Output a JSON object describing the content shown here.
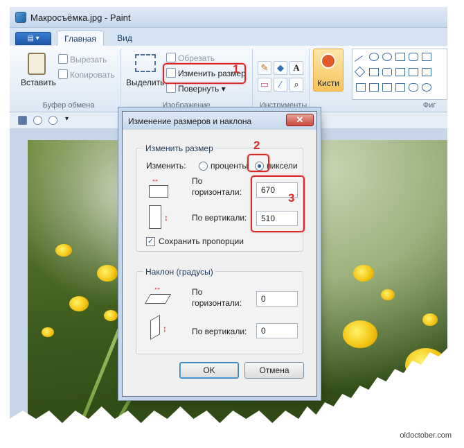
{
  "window": {
    "title": "Макросъёмка.jpg - Paint"
  },
  "tabs": [
    {
      "label": "Главная"
    },
    {
      "label": "Вид"
    }
  ],
  "ribbon": {
    "clipboard": {
      "paste_label": "Вставить",
      "cut_label": "Вырезать",
      "copy_label": "Копировать",
      "group_label": "Буфер обмена"
    },
    "image": {
      "select_label": "Выделить",
      "crop_label": "Обрезать",
      "resize_label": "Изменить размер",
      "rotate_label": "Повернуть",
      "group_label": "Изображение"
    },
    "tools": {
      "group_label": "Инструменты",
      "text_tool": "A"
    },
    "brushes": {
      "label": "Кисти"
    },
    "shapes": {
      "group_label": "Фиг"
    }
  },
  "dialog": {
    "title": "Изменение размеров и наклона",
    "close_glyph": "✕",
    "resize": {
      "legend": "Изменить размер",
      "by_label": "Изменить:",
      "percent_label": "проценты",
      "pixels_label": "пиксели",
      "selected_mode": "pixels",
      "horizontal_label_1": "По",
      "horizontal_label_2": "горизонтали:",
      "horizontal_value": "670",
      "vertical_label": "По вертикали:",
      "vertical_value": "510",
      "keep_ratio_label": "Сохранить пропорции",
      "keep_ratio_checked": true
    },
    "skew": {
      "legend": "Наклон (градусы)",
      "horizontal_label_1": "По",
      "horizontal_label_2": "горизонтали:",
      "horizontal_value": "0",
      "vertical_label": "По вертикали:",
      "vertical_value": "0"
    },
    "ok_label": "OK",
    "cancel_label": "Отмена"
  },
  "annotations": {
    "step1": "1",
    "step2": "2",
    "step3": "3"
  },
  "watermark": "oldoctober.com",
  "colors": {
    "highlight": "#d92a2a",
    "brush_button": "#f7c35a"
  }
}
